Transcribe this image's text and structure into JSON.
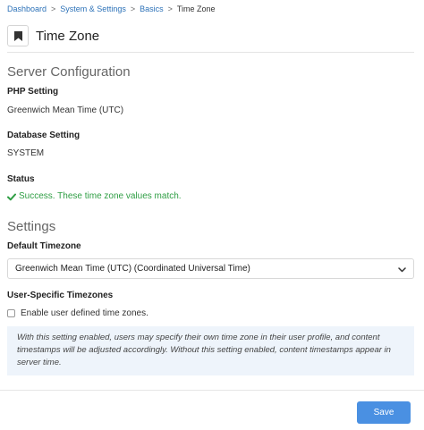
{
  "breadcrumb": {
    "items": [
      "Dashboard",
      "System & Settings",
      "Basics"
    ],
    "separator": ">",
    "current": "Time Zone"
  },
  "page": {
    "title": "Time Zone",
    "icon": "bookmark-icon"
  },
  "server_configuration": {
    "heading": "Server Configuration",
    "php_setting": {
      "label": "PHP Setting",
      "value": "Greenwich Mean Time (UTC)"
    },
    "database_setting": {
      "label": "Database Setting",
      "value": "SYSTEM"
    },
    "status": {
      "label": "Status",
      "value": "Success. These time zone values match.",
      "icon": "checkmark-icon",
      "color": "#2f9e44"
    }
  },
  "settings": {
    "heading": "Settings",
    "default_timezone": {
      "label": "Default Timezone",
      "selected": "Greenwich Mean Time (UTC) (Coordinated Universal Time)"
    },
    "user_specific": {
      "label": "User-Specific Timezones",
      "checkbox_label": "Enable user defined time zones.",
      "checked": false,
      "help_text": "With this setting enabled, users may specify their own time zone in their user profile, and content timestamps will be adjusted accordingly. Without this setting enabled, content timestamps appear in server time."
    }
  },
  "actions": {
    "save_label": "Save",
    "accent": "#4a90e2"
  }
}
